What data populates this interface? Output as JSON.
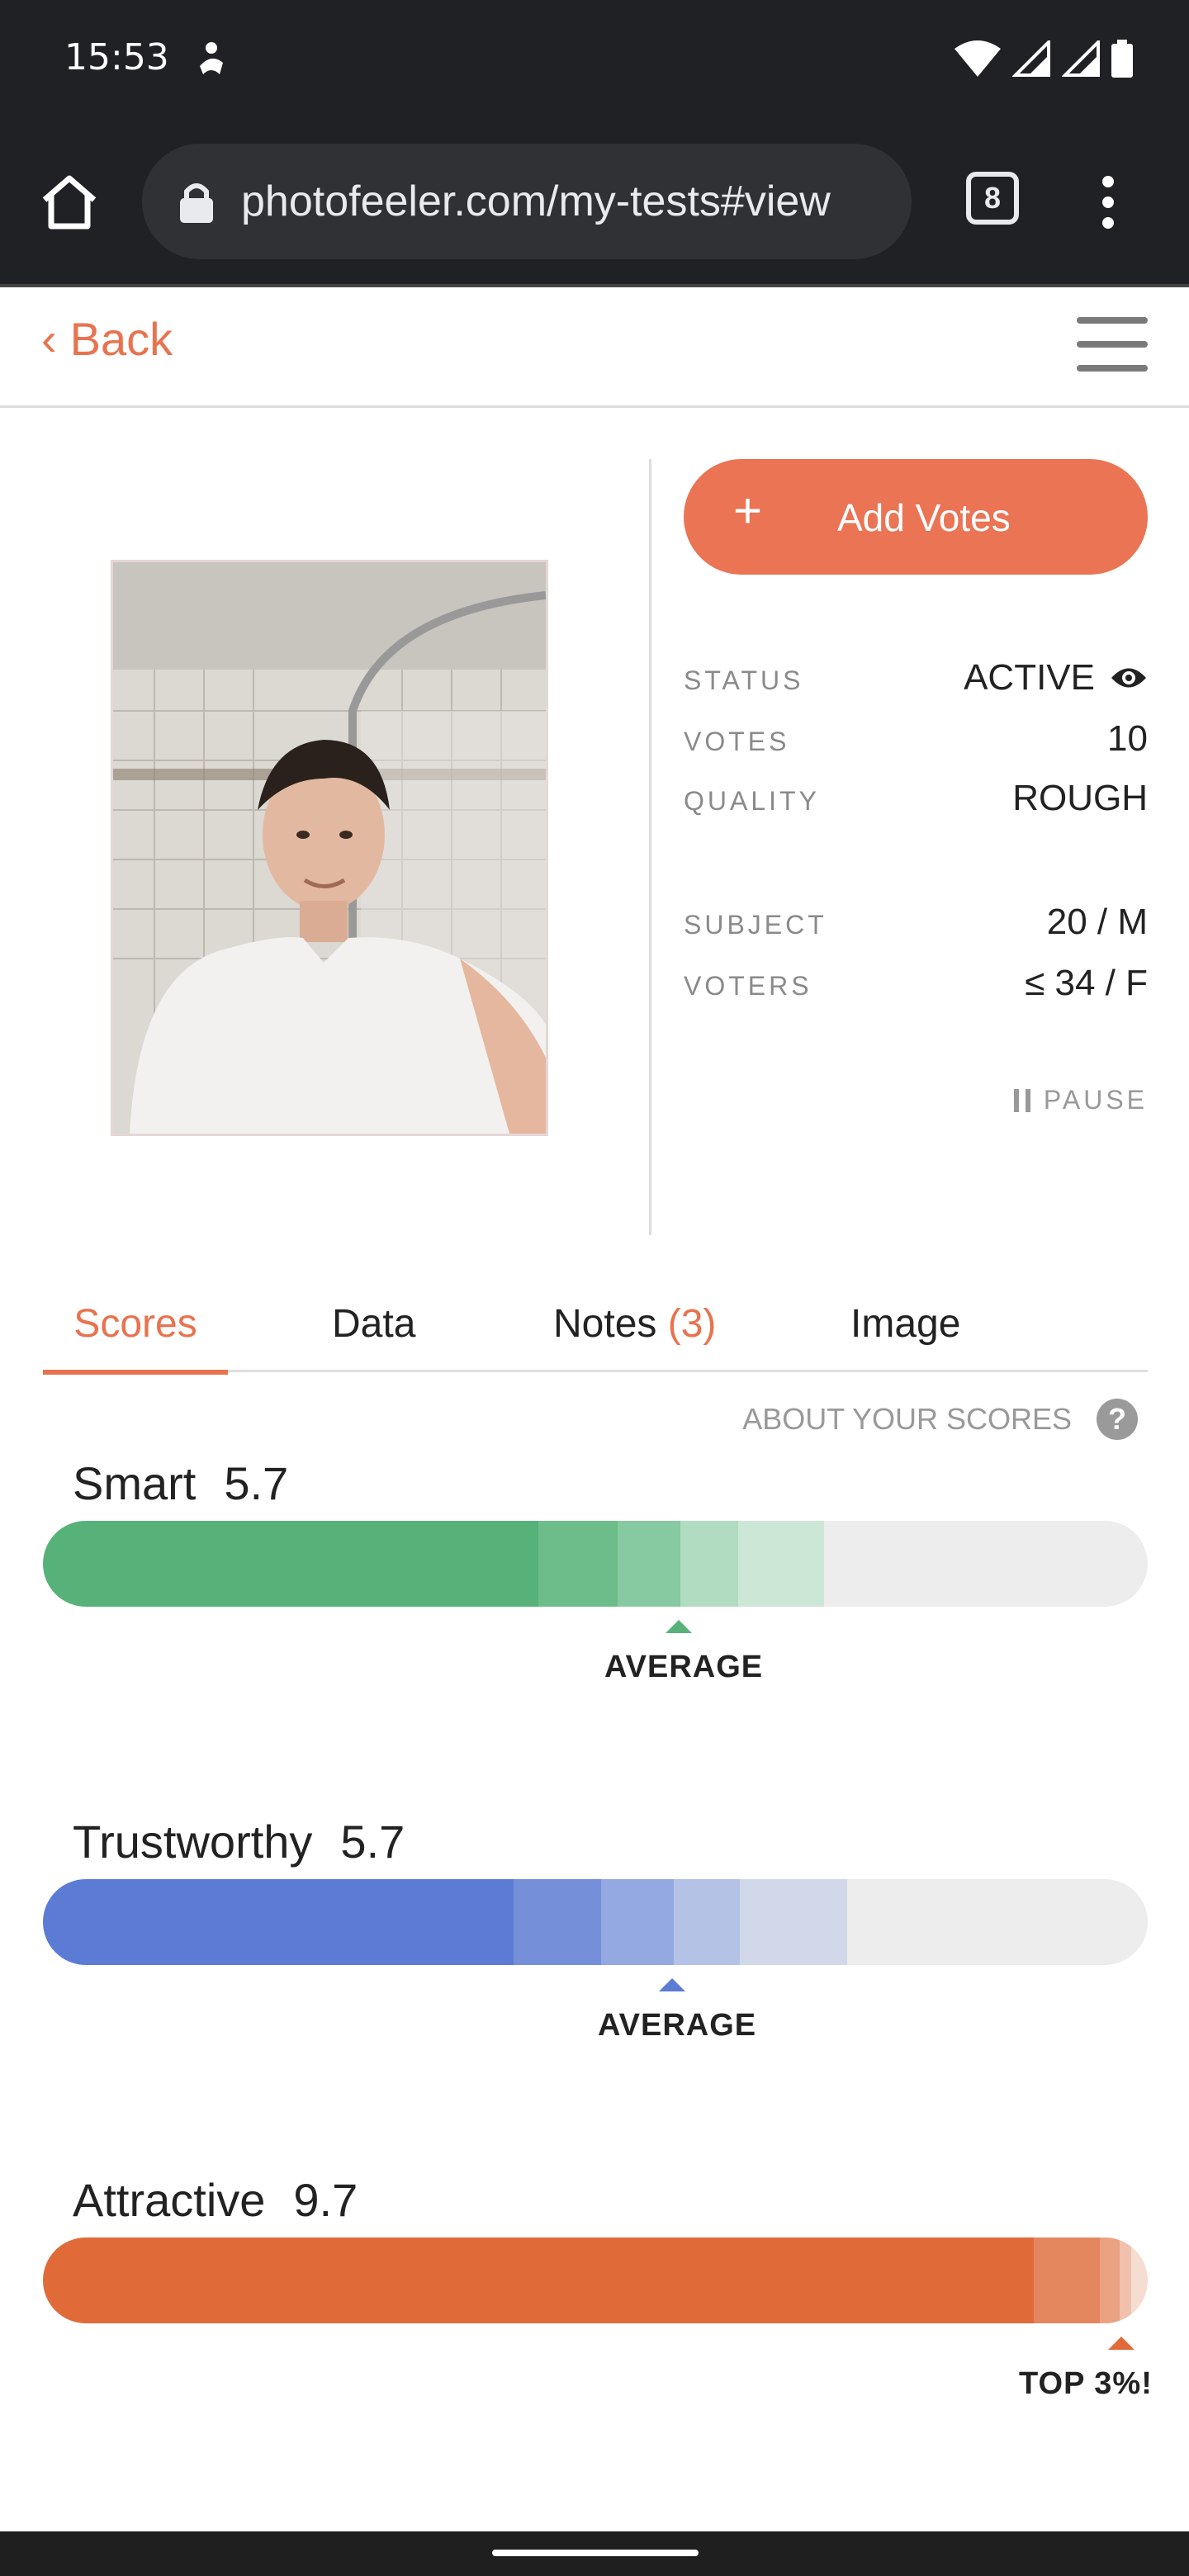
{
  "status_bar": {
    "time": "15:53"
  },
  "browser": {
    "url": "photofeeler.com/my-tests#view",
    "tab_count": "8"
  },
  "header": {
    "back_label": "Back"
  },
  "actions": {
    "add_votes_plus": "+",
    "add_votes_label": "Add Votes",
    "pause_label": "PAUSE"
  },
  "info": {
    "status_key": "STATUS",
    "status_val": "ACTIVE",
    "votes_key": "VOTES",
    "votes_val": "10",
    "quality_key": "QUALITY",
    "quality_val": "ROUGH",
    "subject_key": "SUBJECT",
    "subject_val": "20 / M",
    "voters_key": "VOTERS",
    "voters_val": "≤ 34 / F"
  },
  "tabs": {
    "scores": "Scores",
    "data": "Data",
    "notes": "Notes",
    "notes_count": "(3)",
    "image": "Image"
  },
  "about_scores": "ABOUT YOUR SCORES",
  "help_glyph": "?",
  "scores": [
    {
      "label": "Smart",
      "value": "5.7",
      "marker": "AVERAGE",
      "color": "#57b27a"
    },
    {
      "label": "Trustworthy",
      "value": "5.7",
      "marker": "AVERAGE",
      "color": "#5b7bd5"
    },
    {
      "label": "Attractive",
      "value": "9.7",
      "marker": "TOP 3%!",
      "color": "#e06b39"
    }
  ]
}
